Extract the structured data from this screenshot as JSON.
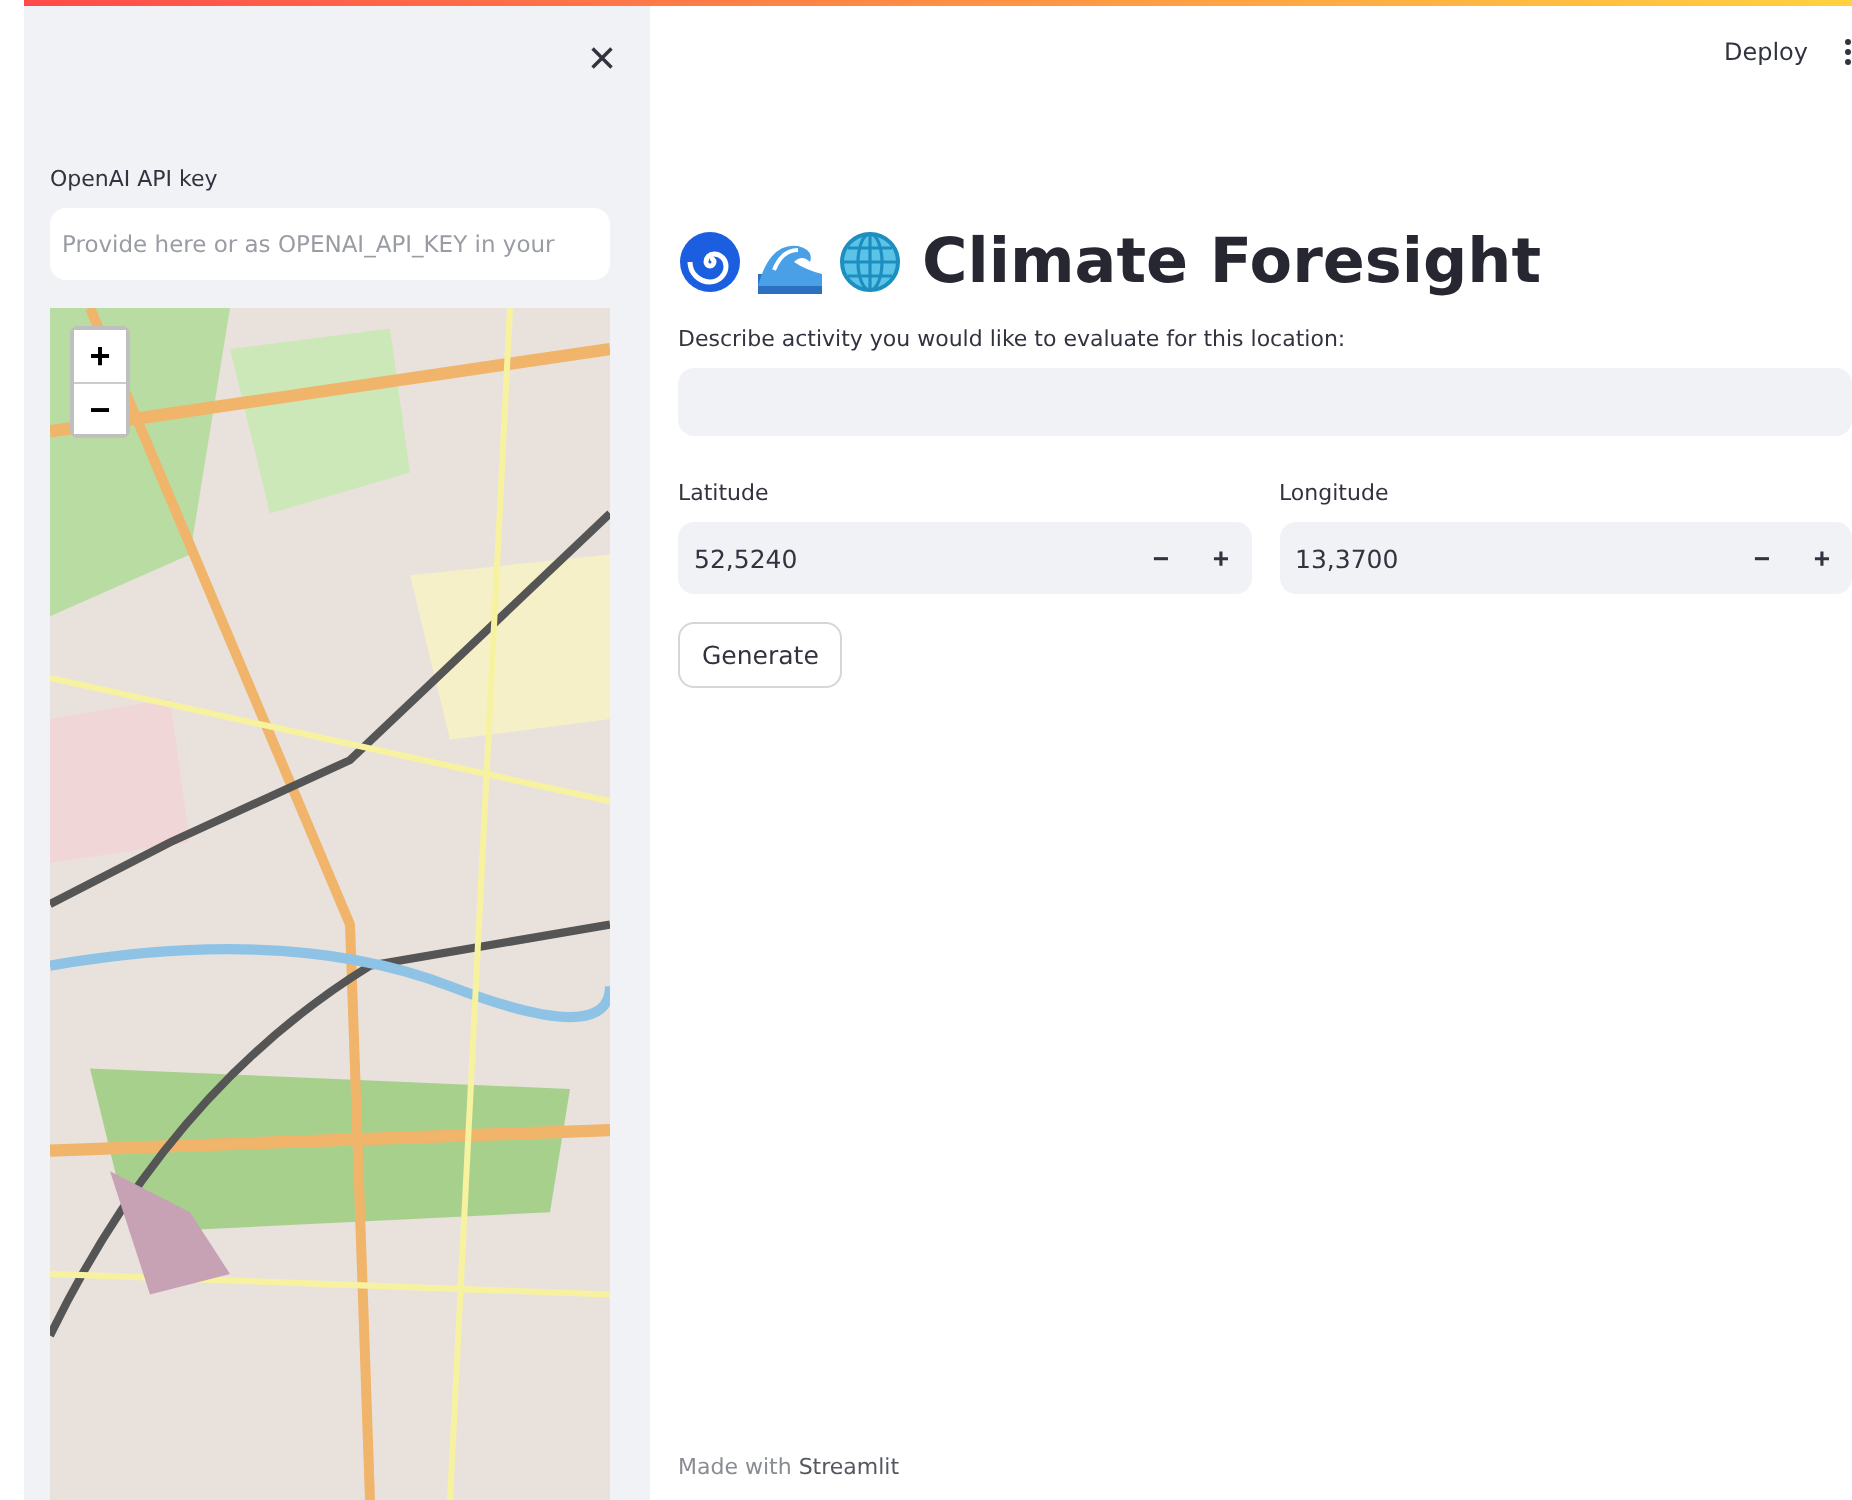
{
  "sidebar": {
    "close": "×",
    "api_key": {
      "label": "OpenAI API key",
      "placeholder": "Provide here or as OPENAI_API_KEY in your"
    },
    "map": {
      "zoom_in": "+",
      "zoom_out": "−"
    }
  },
  "header": {
    "deploy": "Deploy"
  },
  "main": {
    "title": "Climate Foresight",
    "activity": {
      "label": "Describe activity you would like to evaluate for this location:"
    },
    "inputs": [
      {
        "label": "Latitude",
        "value": "52,5240",
        "minus": "−",
        "plus": "+"
      },
      {
        "label": "Longitude",
        "value": "13,3700",
        "minus": "−",
        "plus": "+"
      }
    ],
    "button": "Generate",
    "footer": "Made with **Streamlit**"
  }
}
